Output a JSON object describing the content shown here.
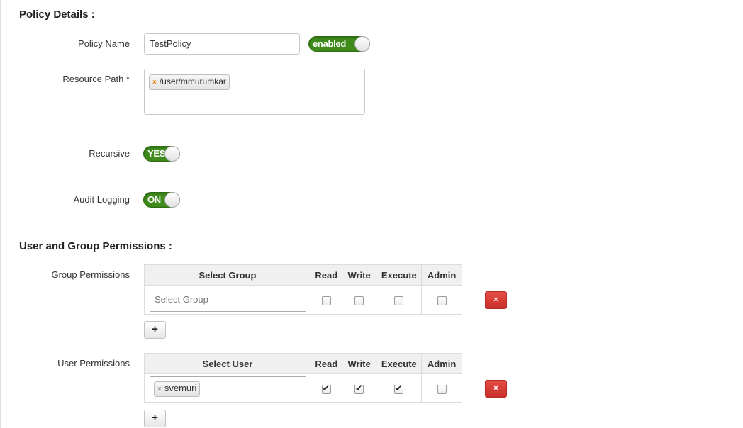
{
  "policy_details": {
    "title": "Policy Details :",
    "policy_name_label": "Policy Name",
    "policy_name_value": "TestPolicy",
    "policy_status_label": "enabled",
    "resource_path_label": "Resource Path *",
    "resource_path_tag_remove": "×",
    "resource_path_tags": [
      "/user/mmurumkar"
    ],
    "recursive_label": "Recursive",
    "recursive_toggle": "YES",
    "audit_logging_label": "Audit Logging",
    "audit_logging_toggle": "ON"
  },
  "permissions": {
    "title": "User and Group Permissions :",
    "group": {
      "label": "Group Permissions",
      "headers": [
        "Select Group",
        "Read",
        "Write",
        "Execute",
        "Admin"
      ],
      "placeholder": "Select Group",
      "checked": {
        "read": false,
        "write": false,
        "execute": false,
        "admin": false
      }
    },
    "user": {
      "label": "User Permissions",
      "headers": [
        "Select User",
        "Read",
        "Write",
        "Execute",
        "Admin"
      ],
      "tag_remove": "×",
      "selected_user": "svemuri",
      "checked": {
        "read": true,
        "write": true,
        "execute": true,
        "admin": false
      }
    },
    "delete_label": "×",
    "add_label": "+"
  },
  "colors": {
    "toggle_green": "#3e8a1b",
    "section_rule": "#8cb33c",
    "delete_red": "#d9433b",
    "tag_x_orange": "#e07b00"
  }
}
